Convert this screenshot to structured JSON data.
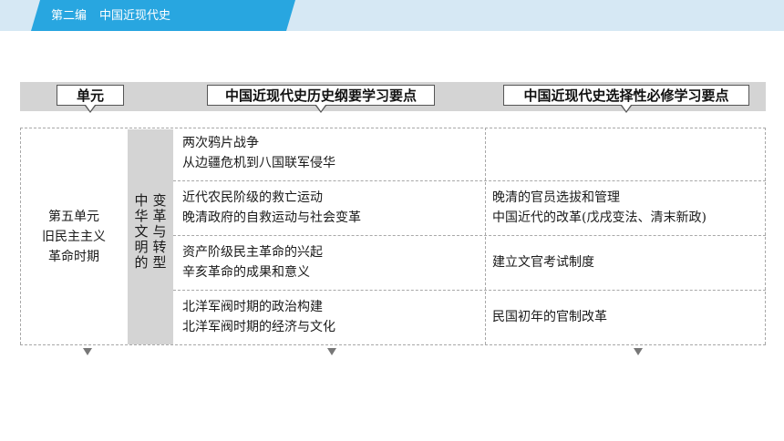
{
  "header": {
    "section": "第二编",
    "subject": "中国近现代史"
  },
  "table": {
    "headers": [
      "单元",
      "中国近现代史历史纲要学习要点",
      "中国近现代史选择性必修学习要点"
    ],
    "unit": [
      "第五单元",
      "旧民主主义",
      "革命时期"
    ],
    "theme_col1": [
      "中",
      "华",
      "文",
      "明",
      "的"
    ],
    "theme_col2": [
      "变",
      "革",
      "与",
      "转",
      "型"
    ],
    "rows": [
      {
        "outline": [
          "两次鸦片战争",
          "从边疆危机到八国联军侵华"
        ],
        "elective": []
      },
      {
        "outline": [
          "近代农民阶级的救亡运动",
          "晚清政府的自救运动与社会变革"
        ],
        "elective": [
          "晚清的官员选拔和管理",
          "中国近代的改革(戊戌变法、清末新政)"
        ]
      },
      {
        "outline": [
          "资产阶级民主革命的兴起",
          "辛亥革命的成果和意义"
        ],
        "elective": [
          "建立文官考试制度"
        ]
      },
      {
        "outline": [
          "北洋军阀时期的政治构建",
          "北洋军阀时期的经济与文化"
        ],
        "elective": [
          "民国初年的官制改革"
        ]
      }
    ]
  }
}
